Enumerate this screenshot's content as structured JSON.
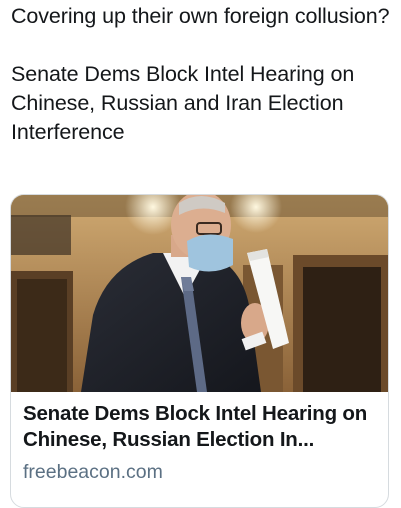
{
  "tweet": {
    "lines": [
      "Covering up their own foreign collusion?",
      "Senate Dems Block Intel Hearing on Chinese, Russian and Iran Election Interference"
    ]
  },
  "card": {
    "image_description": "photo-of-man-in-suit-wearing-face-mask-holding-papers",
    "title": "Senate Dems Block Intel Hearing on Chinese, Russian Election In...",
    "domain": "freebeacon.com"
  }
}
